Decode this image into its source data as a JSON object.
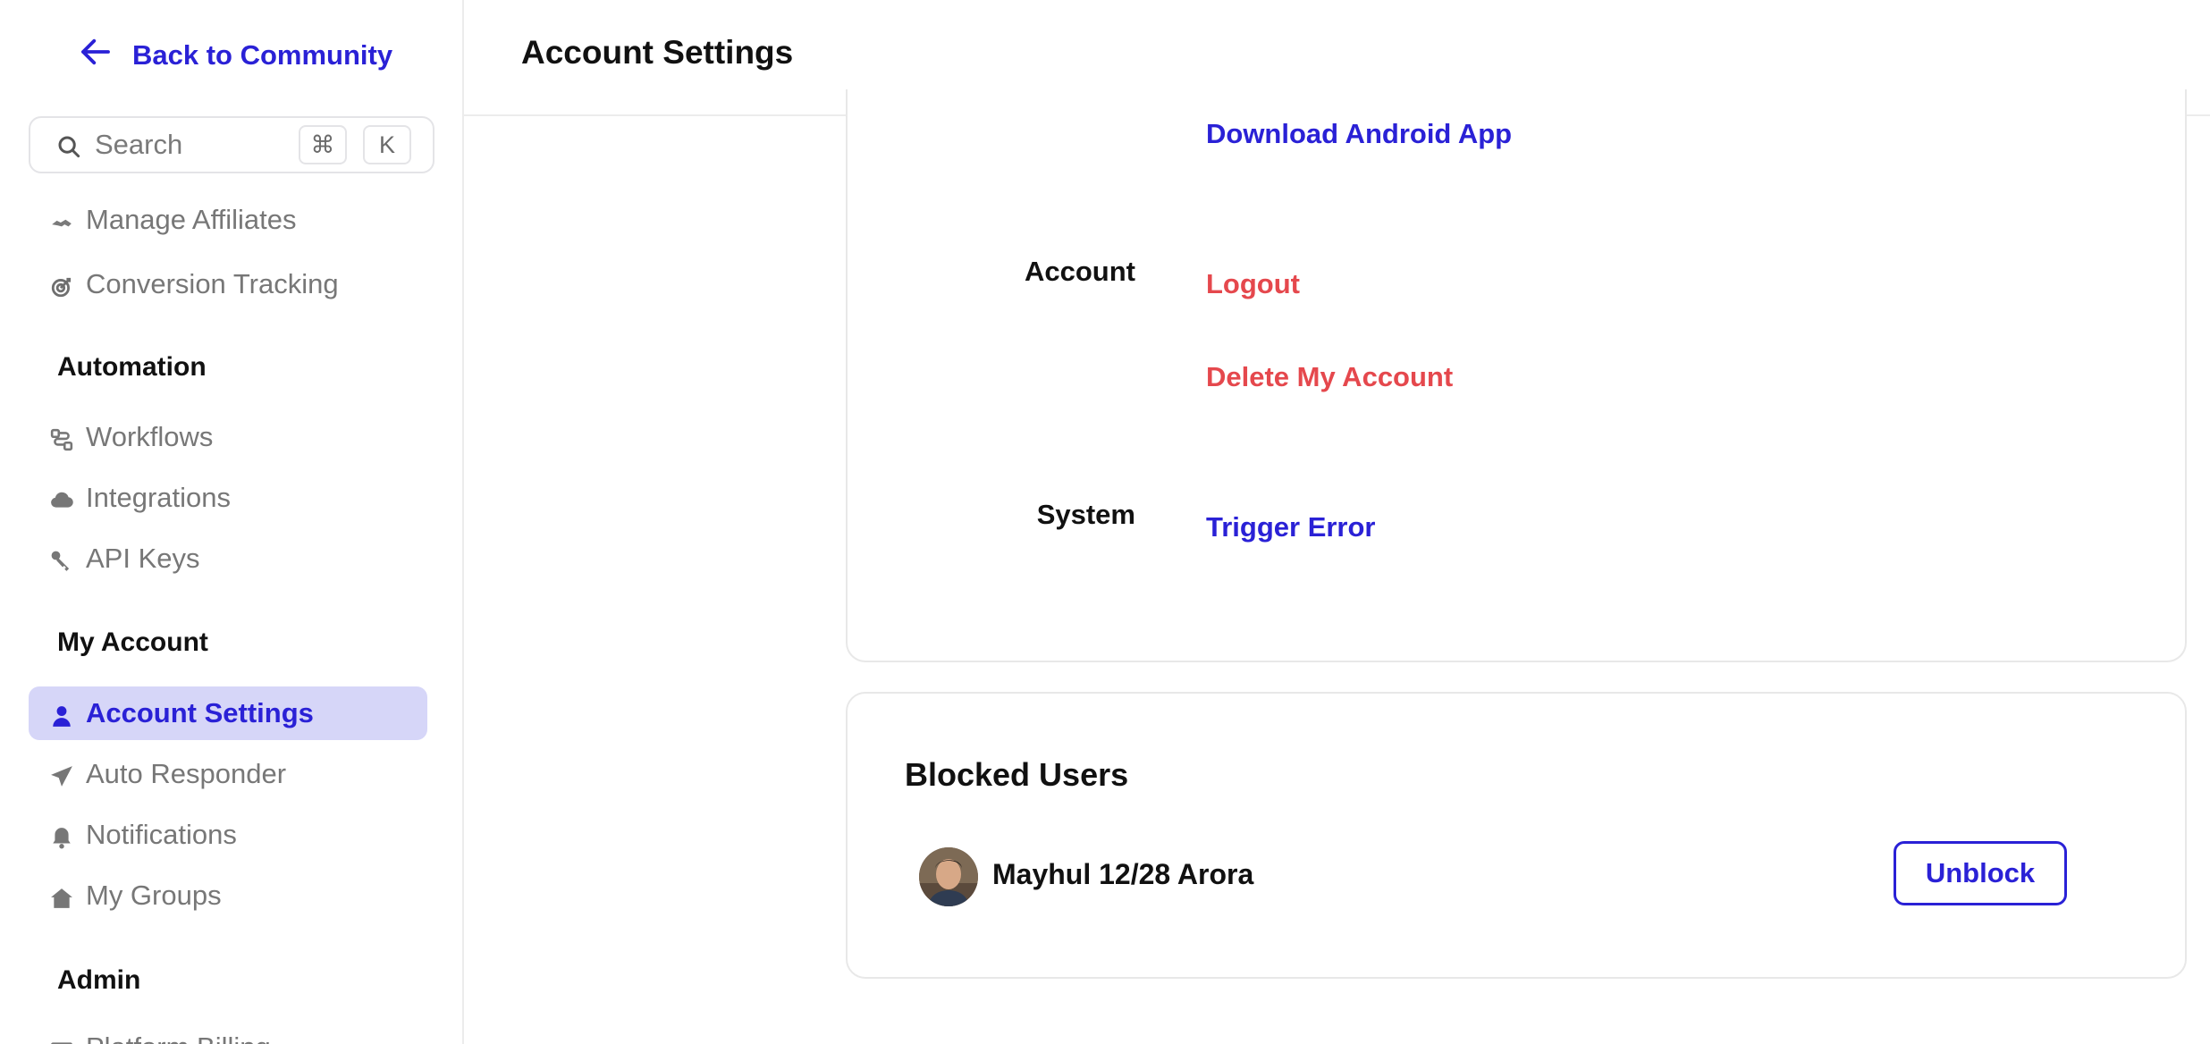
{
  "sidebar": {
    "back_label": "Back to Community",
    "search": {
      "placeholder": "Search",
      "shortcut_keys": [
        "⌘",
        "K"
      ]
    },
    "items": [
      {
        "label": "Manage Affiliates",
        "icon": "handshake-icon"
      },
      {
        "label": "Conversion Tracking",
        "icon": "target-icon"
      }
    ],
    "sections": [
      {
        "title": "Automation",
        "items": [
          {
            "label": "Workflows",
            "icon": "workflow-icon"
          },
          {
            "label": "Integrations",
            "icon": "cloud-icon"
          },
          {
            "label": "API Keys",
            "icon": "key-icon"
          }
        ]
      },
      {
        "title": "My Account",
        "items": [
          {
            "label": "Account Settings",
            "icon": "user-icon",
            "active": true
          },
          {
            "label": "Auto Responder",
            "icon": "paper-plane-icon"
          },
          {
            "label": "Notifications",
            "icon": "bell-icon"
          },
          {
            "label": "My Groups",
            "icon": "house-icon"
          }
        ]
      },
      {
        "title": "Admin",
        "items": [
          {
            "label": "Platform Billing",
            "icon": "card-icon"
          }
        ]
      }
    ]
  },
  "header": {
    "title": "Account Settings"
  },
  "settings": {
    "download_android": "Download Android App",
    "account_label": "Account",
    "logout": "Logout",
    "delete_account": "Delete My Account",
    "system_label": "System",
    "trigger_error": "Trigger Error"
  },
  "blocked_users": {
    "title": "Blocked Users",
    "users": [
      {
        "name": "Mayhul 12/28 Arora",
        "action": "Unblock"
      }
    ]
  },
  "colors": {
    "accent": "#2a21d6",
    "danger": "#e5484d",
    "active_bg": "#d6d6f8",
    "border": "#e8e8e8"
  }
}
